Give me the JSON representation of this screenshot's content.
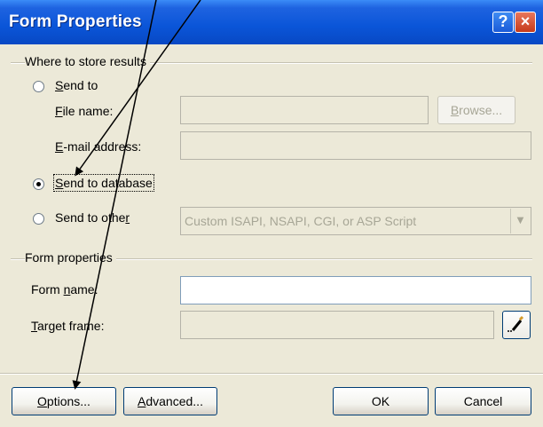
{
  "dialog": {
    "title": "Form Properties",
    "help_button": "?",
    "close_button": "×"
  },
  "where_to_store": {
    "group_label": "Where to store results",
    "send_to": {
      "label_first": "S",
      "label_rest": "end to",
      "checked": false
    },
    "file_name": {
      "label_first": "F",
      "label_rest": "ile name:",
      "value": ""
    },
    "browse_button": {
      "label_first": "B",
      "label_rest": "rowse..."
    },
    "email_address": {
      "label_first": "E",
      "label_rest": "-mail address:",
      "value": ""
    },
    "send_to_database": {
      "label_first": "S",
      "label_rest": "end to database",
      "checked": true
    },
    "send_to_other": {
      "label_pre": "Send to othe",
      "label_u": "r",
      "checked": false,
      "selected_value": "Custom ISAPI, NSAPI, CGI, or ASP Script"
    }
  },
  "form_properties": {
    "group_label": "Form properties",
    "form_name": {
      "label_pre": "Form ",
      "label_u": "n",
      "label_post": "ame:",
      "value": ""
    },
    "target_frame": {
      "label_first": "T",
      "label_rest": "arget frame:",
      "value": ""
    }
  },
  "buttons": {
    "options": {
      "label_first": "O",
      "label_rest": "ptions..."
    },
    "advanced": {
      "label_first": "A",
      "label_rest": "dvanced..."
    },
    "ok": "OK",
    "cancel": "Cancel"
  },
  "colors": {
    "title_bar": "#0A55D8",
    "dialog_bg": "#ECE9D8",
    "close_button": "#C63A1A"
  }
}
